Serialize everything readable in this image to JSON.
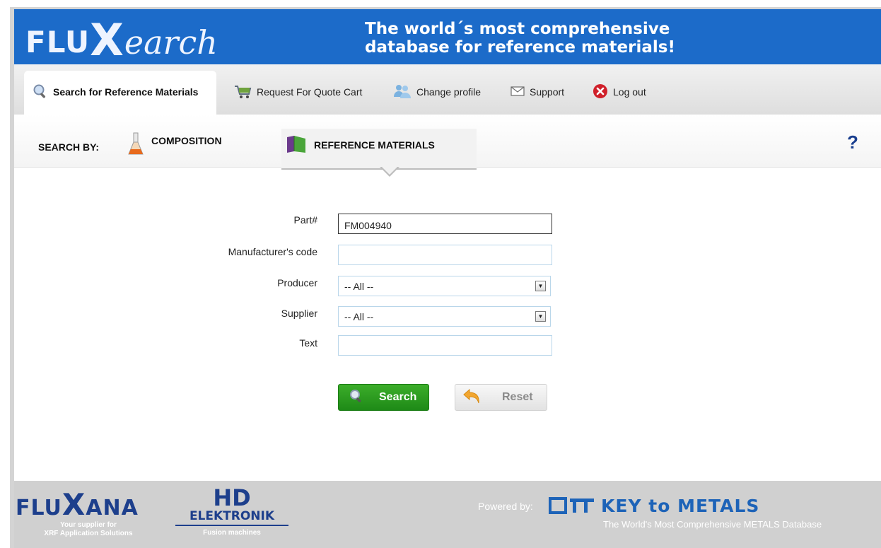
{
  "header": {
    "logo_prefix": "FLU",
    "logo_x": "X",
    "logo_suffix": "earch",
    "tagline_line1": "The world´s most comprehensive",
    "tagline_line2": "database for reference materials!"
  },
  "nav": {
    "items": [
      {
        "label": "Search for Reference Materials",
        "icon": "magnifier-icon",
        "active": true
      },
      {
        "label": "Request For Quote Cart",
        "icon": "cart-icon"
      },
      {
        "label": "Change profile",
        "icon": "users-icon"
      },
      {
        "label": "Support",
        "icon": "envelope-icon"
      },
      {
        "label": "Log out",
        "icon": "close-circle-icon"
      }
    ]
  },
  "search_by": {
    "label": "SEARCH BY:",
    "tabs": [
      {
        "label": "COMPOSITION",
        "icon": "flask-icon"
      },
      {
        "label": "REFERENCE MATERIALS",
        "icon": "book-icon",
        "active": true
      }
    ],
    "help": "?"
  },
  "form": {
    "part_label": "Part#",
    "part_value": "FM004940",
    "manufacturer_label": "Manufacturer's code",
    "manufacturer_value": "",
    "producer_label": "Producer",
    "producer_value": "-- All --",
    "supplier_label": "Supplier",
    "supplier_value": "-- All --",
    "text_label": "Text",
    "text_value": "",
    "search_button": "Search",
    "reset_button": "Reset"
  },
  "footer": {
    "fluxana_prefix": "FLU",
    "fluxana_x": "X",
    "fluxana_suffix": "ANA",
    "fluxana_tag_line1": "Your supplier for",
    "fluxana_tag_line2": "XRF Application Solutions",
    "hd_line1": "HD",
    "hd_line2": "ELEKTRONIK",
    "hd_line3": "Fusion machines",
    "powered_by": "Powered by:",
    "ktm_title": "KEY to METALS",
    "ktm_subtitle": "The World's Most Comprehensive METALS Database"
  },
  "colors": {
    "banner": "#1c6bc9",
    "search_button": "#2a9a1f",
    "brand_dark": "#1d3f8c"
  }
}
